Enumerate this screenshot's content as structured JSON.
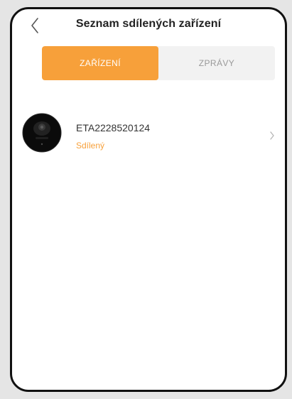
{
  "header": {
    "title": "Seznam sdílených zařízení",
    "back_icon": "chevron-left-icon"
  },
  "tabs": [
    {
      "label": "ZAŘÍZENÍ",
      "active": true
    },
    {
      "label": "ZPRÁVY",
      "active": false
    }
  ],
  "devices": [
    {
      "name": "ETA2228520124",
      "status": "Sdílený",
      "icon": "robot-vacuum-icon"
    }
  ],
  "colors": {
    "accent": "#f7a03a",
    "tab_inactive_bg": "#f2f2f2",
    "inactive_text": "#999999",
    "frame": "#111111",
    "page_bg": "#e5e5e5"
  }
}
